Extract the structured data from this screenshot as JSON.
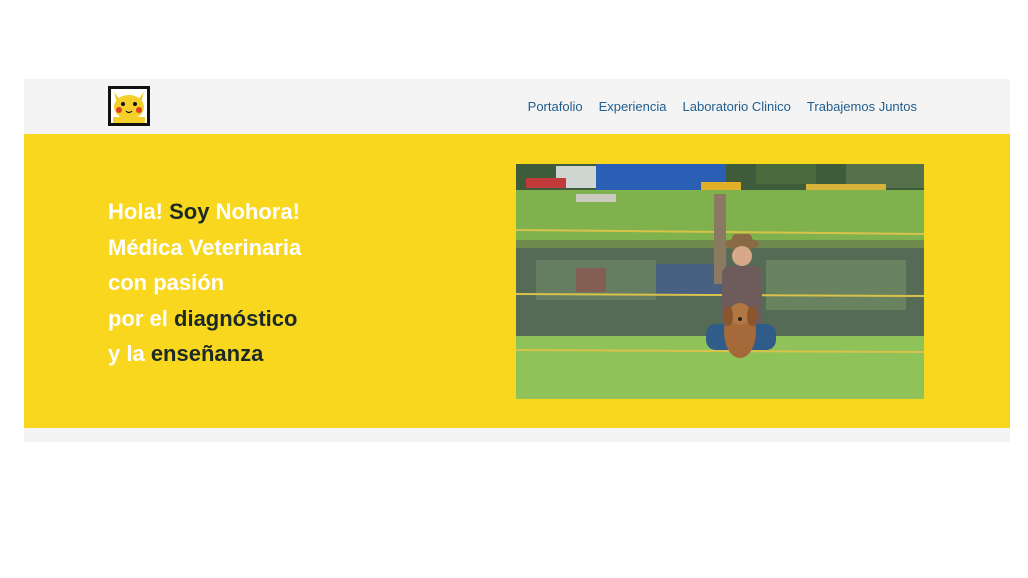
{
  "nav": {
    "logo_alt": "pikachu-logo",
    "links": [
      "Portafolio",
      "Experiencia",
      "Laboratorio Clinico",
      "Trabajemos Juntos"
    ]
  },
  "hero": {
    "headline": {
      "l1a": "Hola! ",
      "l1b": "Soy",
      "l1c": " Nohora!",
      "l2": "Médica Veterinaria",
      "l3": "con pasión",
      "l4a": "por el ",
      "l4b": "diagnóstico",
      "l5a": "y la ",
      "l5b": "enseñanza"
    }
  },
  "colors": {
    "hero_bg": "#f8d71e",
    "nav_link": "#1f5d8f",
    "highlight_text": "#1b2a27"
  }
}
